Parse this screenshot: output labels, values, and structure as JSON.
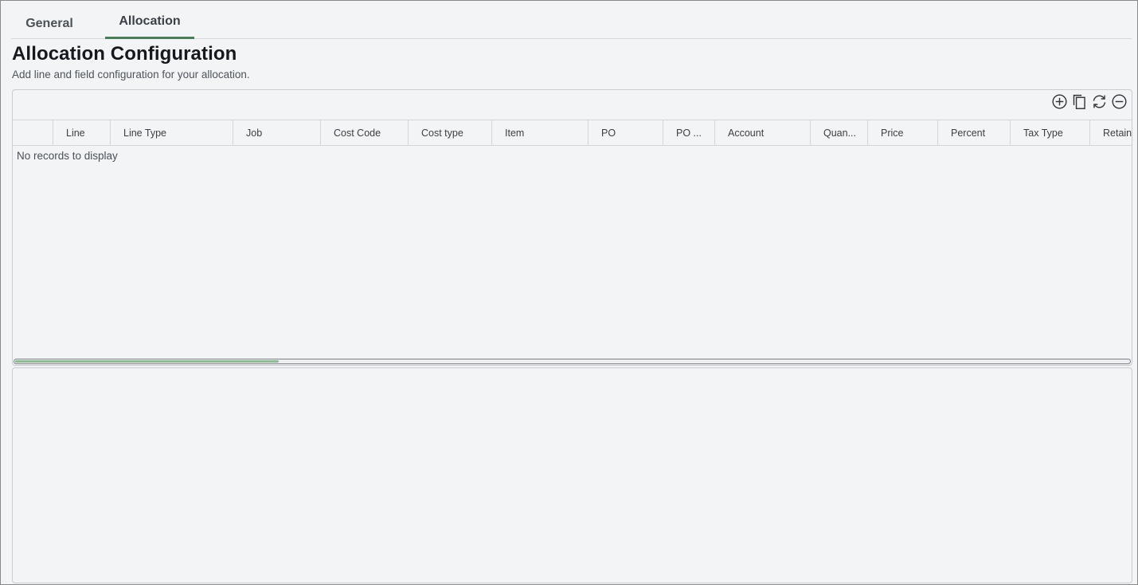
{
  "tabs": [
    {
      "label": "General",
      "active": false
    },
    {
      "label": "Allocation",
      "active": true
    }
  ],
  "header": {
    "title": "Allocation Configuration",
    "subtitle": "Add line and field configuration for your allocation."
  },
  "toolbar": {
    "add_icon": "plus-circle-icon",
    "copy_icon": "copy-icon",
    "refresh_icon": "refresh-icon",
    "remove_icon": "minus-circle-icon"
  },
  "grid": {
    "columns": [
      "",
      "Line",
      "Line Type",
      "Job",
      "Cost Code",
      "Cost type",
      "Item",
      "PO",
      "PO ...",
      "Account",
      "Quan...",
      "Price",
      "Percent",
      "Tax Type",
      "Retain"
    ],
    "empty_message": "No records to display",
    "scroll_position": 0.0
  },
  "colors": {
    "accent": "#4a7c59",
    "scroll_thumb": "#8fb894",
    "background": "#f3f4f6"
  }
}
